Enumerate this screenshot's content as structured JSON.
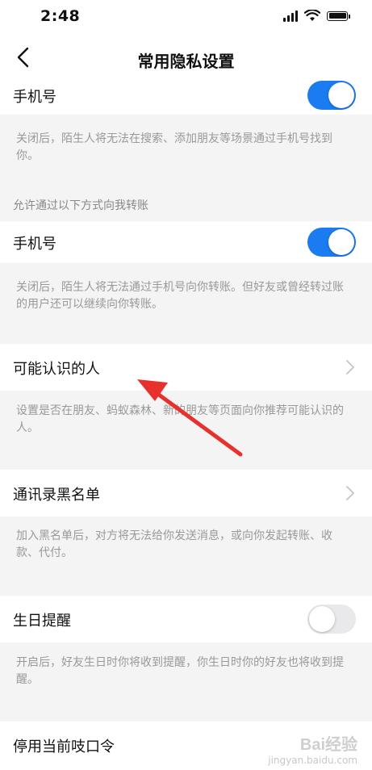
{
  "status": {
    "time": "2:48"
  },
  "nav": {
    "title": "常用隐私设置"
  },
  "phone_search": {
    "label": "手机号",
    "enabled": true,
    "note": "关闭后，陌生人将无法在搜索、添加朋友等场景通过手机号找到你。"
  },
  "transfer": {
    "section_title": "允许通过以下方式向我转账",
    "label": "手机号",
    "enabled": true,
    "note": "关闭后，陌生人将无法通过手机号向你转账。但好友或曾经转过账的用户还可以继续向你转账。"
  },
  "people_you_may_know": {
    "label": "可能认识的人",
    "note": "设置是否在朋友、蚂蚁森林、新的朋友等页面向你推荐可能认识的人。"
  },
  "blacklist": {
    "label": "通讯录黑名单",
    "note": "加入黑名单后，对方将无法给你发送消息，或向你发起转账、收款、代付。"
  },
  "birthday": {
    "label": "生日提醒",
    "enabled": false,
    "note": "开启后，好友生日时你将收到提醒，你生日时你的好友也将收到提醒。"
  },
  "disable_password": {
    "label": "停用当前吱口令"
  },
  "watermark": {
    "main": "Bai经验",
    "sub": "jingyan.baidu.com"
  },
  "colors": {
    "accent": "#1a7cf0",
    "annotation": "#e8302c"
  }
}
